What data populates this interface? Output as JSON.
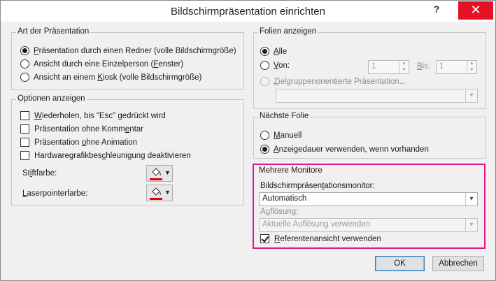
{
  "window": {
    "title": "Bildschirmpräsentation einrichten",
    "help_glyph": "?",
    "close_glyph": "✕"
  },
  "art": {
    "label": "Art der Präsentation",
    "options": [
      {
        "pre": "",
        "u": "P",
        "post": "räsentation durch einen Redner (volle Bildschirmgröße)",
        "selected": true
      },
      {
        "pre": "Ansicht durch eine Einzelperson (",
        "u": "F",
        "post": "enster)",
        "selected": false
      },
      {
        "pre": "Ansicht an einem ",
        "u": "K",
        "post": "iosk (volle Bildschirmgröße)",
        "selected": false
      }
    ]
  },
  "optionen": {
    "label": "Optionen anzeigen",
    "checks": [
      {
        "pre": "",
        "u": "W",
        "post": "iederholen, bis \"Esc\" gedrückt wird",
        "checked": false
      },
      {
        "pre": "Präsentation ohne Komm",
        "u": "e",
        "post": "ntar",
        "checked": false
      },
      {
        "pre": "Präsentation ",
        "u": "o",
        "post": "hne Animation",
        "checked": false
      },
      {
        "pre": "Hardwaregrafikbes",
        "u": "c",
        "post": "hleunigung deaktivieren",
        "checked": false
      }
    ],
    "stift": {
      "pre": "St",
      "u": "i",
      "post": "ftfarbe:"
    },
    "laser": {
      "pre": "",
      "u": "L",
      "post": "aserpointerfarbe:"
    },
    "pen_color": "#e00000",
    "laser_color": "#e00000",
    "pail_icon": "paint-bucket-icon"
  },
  "folien": {
    "label": "Folien anzeigen",
    "alle": {
      "pre": "",
      "u": "A",
      "post": "lle",
      "selected": true
    },
    "von": {
      "pre": "",
      "u": "V",
      "post": "on:",
      "selected": false,
      "value": "1"
    },
    "bis": {
      "pre": "",
      "u": "B",
      "post": "is:",
      "value": "1"
    },
    "ziel": {
      "pre": "",
      "u": "Z",
      "post": "ielgruppenorientierte Präsentation..."
    },
    "ziel_combo": ""
  },
  "naechste": {
    "label": "Nächste Folie",
    "manuell": {
      "pre": "",
      "u": "M",
      "post": "anuell",
      "selected": false
    },
    "anzeige": {
      "pre": "",
      "u": "A",
      "post": "nzeigedauer verwenden, wenn vorhanden",
      "selected": true
    }
  },
  "monitore": {
    "label": "Mehrere Monitore",
    "monitor_label": {
      "pre": "Bildschirmpräsen",
      "u": "t",
      "post": "ationsmonitor:"
    },
    "monitor_value": "Automatisch",
    "aufl_label": {
      "pre": "A",
      "u": "u",
      "post": "flösung:"
    },
    "aufl_value": "Aktuelle Auflösung verwenden",
    "referent": {
      "pre": "",
      "u": "R",
      "post": "eferentenansicht verwenden",
      "checked": true
    },
    "highlight_color": "#e0178c"
  },
  "buttons": {
    "ok": "OK",
    "cancel": "Abbrechen"
  }
}
